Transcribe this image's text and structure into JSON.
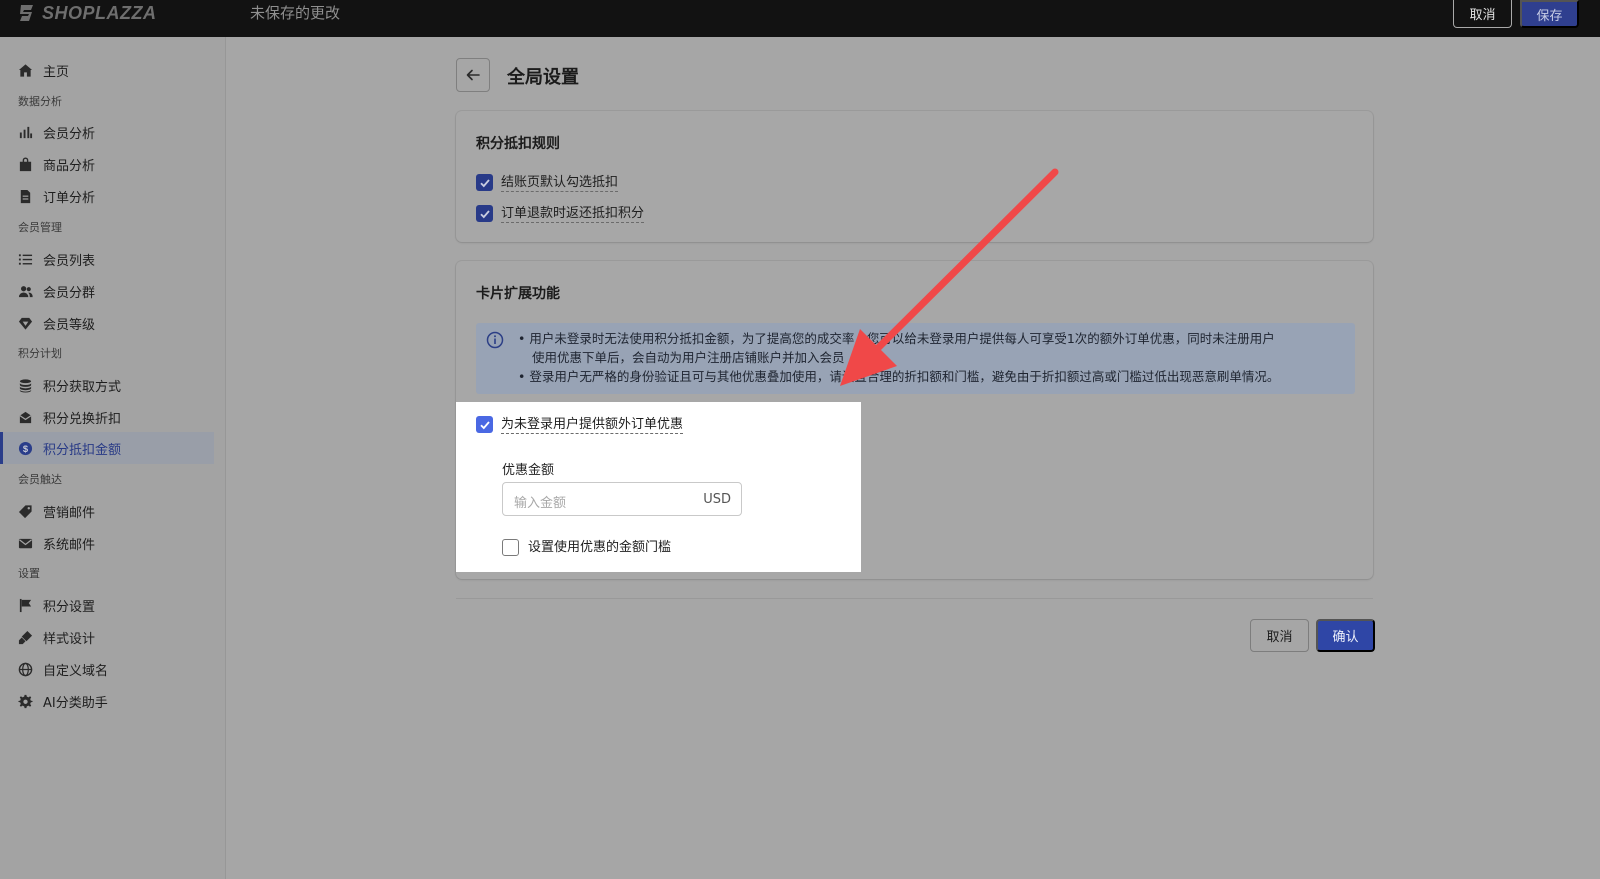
{
  "topbar": {
    "brand": "SHOPLAZZA",
    "status": "未保存的更改",
    "cancel_label": "取消",
    "save_label": "保存"
  },
  "sidebar": {
    "items": [
      {
        "label": "主页",
        "icon": "home-icon"
      },
      {
        "section": "数据分析"
      },
      {
        "label": "会员分析",
        "icon": "bar-chart-icon"
      },
      {
        "label": "商品分析",
        "icon": "bag-icon"
      },
      {
        "label": "订单分析",
        "icon": "document-icon"
      },
      {
        "section": "会员管理"
      },
      {
        "label": "会员列表",
        "icon": "list-icon"
      },
      {
        "label": "会员分群",
        "icon": "users-icon"
      },
      {
        "label": "会员等级",
        "icon": "diamond-icon"
      },
      {
        "section": "积分计划"
      },
      {
        "label": "积分获取方式",
        "icon": "coins-icon"
      },
      {
        "label": "积分兑换折扣",
        "icon": "gift-icon"
      },
      {
        "label": "积分抵扣金额",
        "icon": "dollar-icon",
        "active": true
      },
      {
        "section": "会员触达"
      },
      {
        "label": "营销邮件",
        "icon": "tag-icon"
      },
      {
        "label": "系统邮件",
        "icon": "mail-icon"
      },
      {
        "section": "设置"
      },
      {
        "label": "积分设置",
        "icon": "flag-icon"
      },
      {
        "label": "样式设计",
        "icon": "brush-icon"
      },
      {
        "label": "自定义域名",
        "icon": "globe-icon"
      },
      {
        "label": "AI分类助手",
        "icon": "gear-icon"
      }
    ]
  },
  "page": {
    "title": "全局设置"
  },
  "rules_card": {
    "title": "积分抵扣规则",
    "options": [
      {
        "label": "结账页默认勾选抵扣",
        "checked": true
      },
      {
        "label": "订单退款时返还抵扣积分",
        "checked": true
      }
    ]
  },
  "extension_card": {
    "title": "卡片扩展功能",
    "info_lines": [
      "•  用户未登录时无法使用积分抵扣金额，为了提高您的成交率，您可以给未登录用户提供每人可享受1次的额外订单优惠，同时未注册用户",
      "使用优惠下单后，会自动为用户注册店铺账户并加入会员",
      "•  登录用户无严格的身份验证且可与其他优惠叠加使用，请设置合理的折扣额和门槛，避免由于折扣额过高或门槛过低出现恶意刷单情况。"
    ],
    "extra_offer_label": "为未登录用户提供额外订单优惠",
    "extra_offer_checked": true,
    "amount_label": "优惠金额",
    "amount_placeholder": "输入金额",
    "amount_unit": "USD",
    "threshold_label": "设置使用优惠的金额门槛",
    "threshold_checked": false
  },
  "footer": {
    "cancel_label": "取消",
    "confirm_label": "确认"
  },
  "colors": {
    "accent": "#2f46a6",
    "annotation_arrow": "#f04848"
  }
}
